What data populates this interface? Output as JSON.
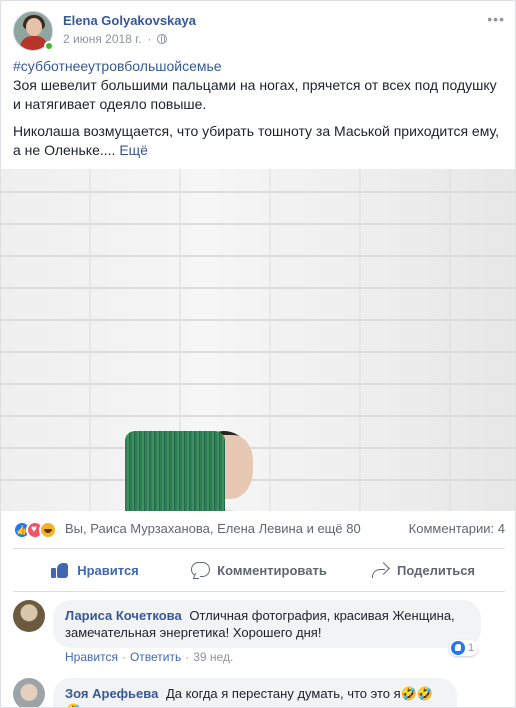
{
  "post": {
    "author": "Elena Golyakovskaya",
    "date": "2 июня 2018 г.",
    "more": "•••",
    "hashtag": "#субботнееутровбольшойсемье",
    "paragraph1": "Зоя шевелит большими пальцами на ногах, прячется от всех под подушку и натягивает одеяло повыше.",
    "paragraph2": "Николаша возмущается, что убирать тошноту за Маськой приходится ему, а не Оленьке....",
    "see_more": "Ещё"
  },
  "reactions": {
    "text": "Вы, Раиса Мурзаханова, Елена Левина и ещё 80",
    "comments_count": "Комментарии: 4",
    "icons": [
      "like-icon",
      "love-icon",
      "haha-icon"
    ],
    "colors": {
      "like": "#2078f4",
      "love": "#f25268",
      "haha": "#f7b125"
    }
  },
  "actions": {
    "like": "Нравится",
    "comment": "Комментировать",
    "share": "Поделиться"
  },
  "comments": [
    {
      "name": "Лариса Кочеткова",
      "text_line1": "Отличная фотография, красивая Женщина,",
      "text_line2": "замечательная энергетика! Хорошего дня!",
      "like": "Нравится",
      "reply": "Ответить",
      "age": "39 нед.",
      "likes": "1"
    },
    {
      "name": "Зоя Арефьева",
      "text": "Да когда я перестану думать, что это я🤣🤣🤣"
    }
  ]
}
